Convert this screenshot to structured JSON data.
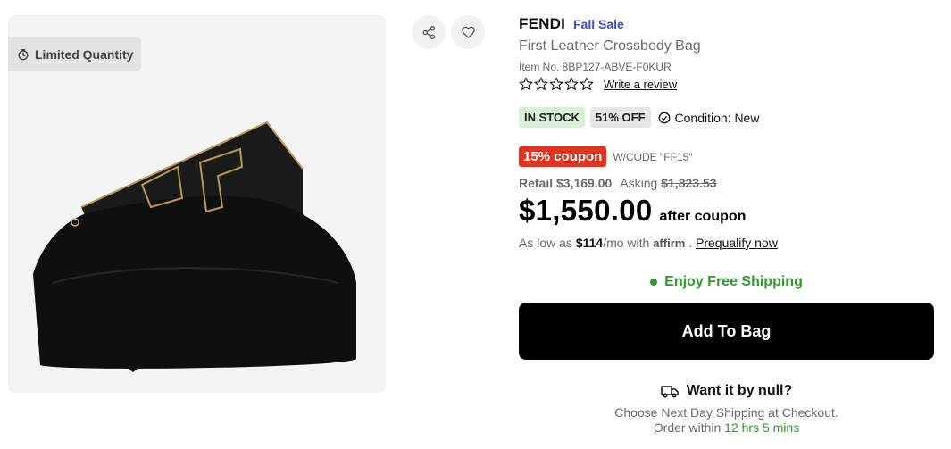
{
  "badge": {
    "label": "Limited Quantity",
    "icon": "stopwatch-icon"
  },
  "actions": {
    "share_icon": "share-icon",
    "favorite_icon": "heart-icon"
  },
  "product": {
    "brand": "FENDI",
    "sale_tag": "Fall Sale",
    "name": "First Leather Crossbody Bag",
    "item_no": "Item No. 8BP127-ABVE-F0KUR",
    "rating_stars": 0,
    "review_link": "Write a review"
  },
  "status": {
    "stock": "IN STOCK",
    "discount": "51% OFF",
    "condition": "Condition: New"
  },
  "coupon": {
    "label": "15% coupon",
    "code_text": "W/CODE \"FF15\""
  },
  "pricing": {
    "retail_label": "Retail",
    "retail_value": "$3,169.00",
    "asking_label": "Asking",
    "asking_value": "$1,823.53",
    "price": "$1,550.00",
    "price_note": "after coupon"
  },
  "financing": {
    "prefix": "As low as",
    "monthly": "$114",
    "suffix": "/mo with",
    "provider": "affirm",
    "separator": ".",
    "link": "Prequalify now"
  },
  "shipping": {
    "label": "Enjoy Free Shipping"
  },
  "cart": {
    "button_label": "Add To Bag"
  },
  "delivery": {
    "title": "Want it by null?",
    "note": "Choose Next Day Shipping at Checkout.",
    "order_prefix": "Order within",
    "time_left": "12 hrs 5 mins"
  },
  "colors": {
    "sale_blue": "#3b4cd0",
    "coupon_red": "#e0341e",
    "success_green": "#2f9b2f",
    "stock_bg": "#d8f0d8"
  }
}
